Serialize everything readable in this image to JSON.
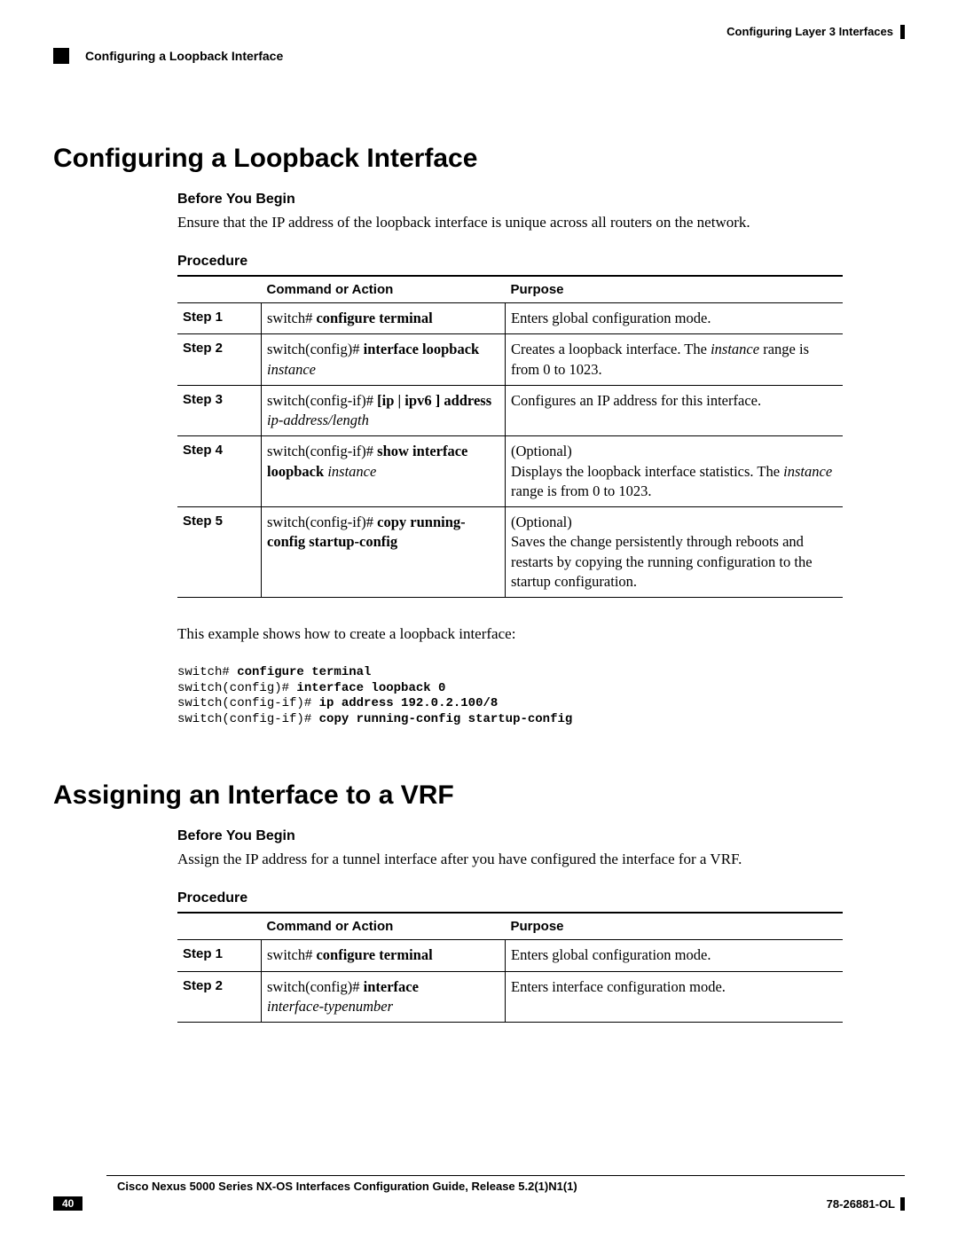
{
  "header": {
    "right": "Configuring Layer 3 Interfaces",
    "left": "Configuring a Loopback Interface"
  },
  "section1": {
    "title": "Configuring a Loopback Interface",
    "before_label": "Before You Begin",
    "before_text": "Ensure that the IP address of the loopback interface is unique across all routers on the network.",
    "procedure_label": "Procedure",
    "th_cmd": "Command or Action",
    "th_purpose": "Purpose",
    "steps": [
      {
        "step": "Step 1",
        "cmd_prefix": "switch# ",
        "cmd_bold": "configure terminal",
        "cmd_suffix": "",
        "cmd_italic": "",
        "purpose": "Enters global configuration mode."
      },
      {
        "step": "Step 2",
        "cmd_prefix": "switch(config)# ",
        "cmd_bold": "interface loopback",
        "cmd_suffix": "",
        "cmd_italic": "instance",
        "purpose_pre": "Creates a loopback interface. The ",
        "purpose_italic": "instance",
        "purpose_post": " range is from 0 to 1023."
      },
      {
        "step": "Step 3",
        "cmd_prefix": "switch(config-if)# ",
        "cmd_bold": "[ip | ipv6 ] address",
        "cmd_suffix": "",
        "cmd_italic": "ip-address/length",
        "purpose": "Configures an IP address for this interface."
      },
      {
        "step": "Step 4",
        "cmd_prefix": "switch(config-if)# ",
        "cmd_bold": "show interface loopback",
        "cmd_suffix": " ",
        "cmd_italic": "instance",
        "purpose_line1": "(Optional)",
        "purpose_pre": "Displays the loopback interface statistics. The ",
        "purpose_italic": "instance",
        "purpose_post": " range is from 0 to 1023."
      },
      {
        "step": "Step 5",
        "cmd_prefix": "switch(config-if)# ",
        "cmd_bold": "copy running-config startup-config",
        "cmd_suffix": "",
        "cmd_italic": "",
        "purpose_line1": "(Optional)",
        "purpose": "Saves the change persistently through reboots and restarts by copying the running configuration to the startup configuration."
      }
    ],
    "example_intro": "This example shows how to create a loopback interface:",
    "code": {
      "l1p": "switch# ",
      "l1b": "configure terminal",
      "l2p": "switch(config)# ",
      "l2b": "interface loopback 0",
      "l3p": "switch(config-if)# ",
      "l3b": "ip address 192.0.2.100/8",
      "l4p": "switch(config-if)# ",
      "l4b": "copy running-config startup-config"
    }
  },
  "section2": {
    "title": "Assigning an Interface to a VRF",
    "before_label": "Before You Begin",
    "before_text": "Assign the IP address for a tunnel interface after you have configured the interface for a VRF.",
    "procedure_label": "Procedure",
    "th_cmd": "Command or Action",
    "th_purpose": "Purpose",
    "steps": [
      {
        "step": "Step 1",
        "cmd_prefix": "switch# ",
        "cmd_bold": "configure terminal",
        "cmd_italic": "",
        "purpose": "Enters global configuration mode."
      },
      {
        "step": "Step 2",
        "cmd_prefix": "switch(config)# ",
        "cmd_bold": "interface",
        "cmd_italic": "interface-typenumber",
        "purpose": "Enters interface configuration mode."
      }
    ]
  },
  "footer": {
    "guide": "Cisco Nexus 5000 Series NX-OS Interfaces Configuration Guide, Release 5.2(1)N1(1)",
    "page": "40",
    "docid": "78-26881-OL"
  }
}
